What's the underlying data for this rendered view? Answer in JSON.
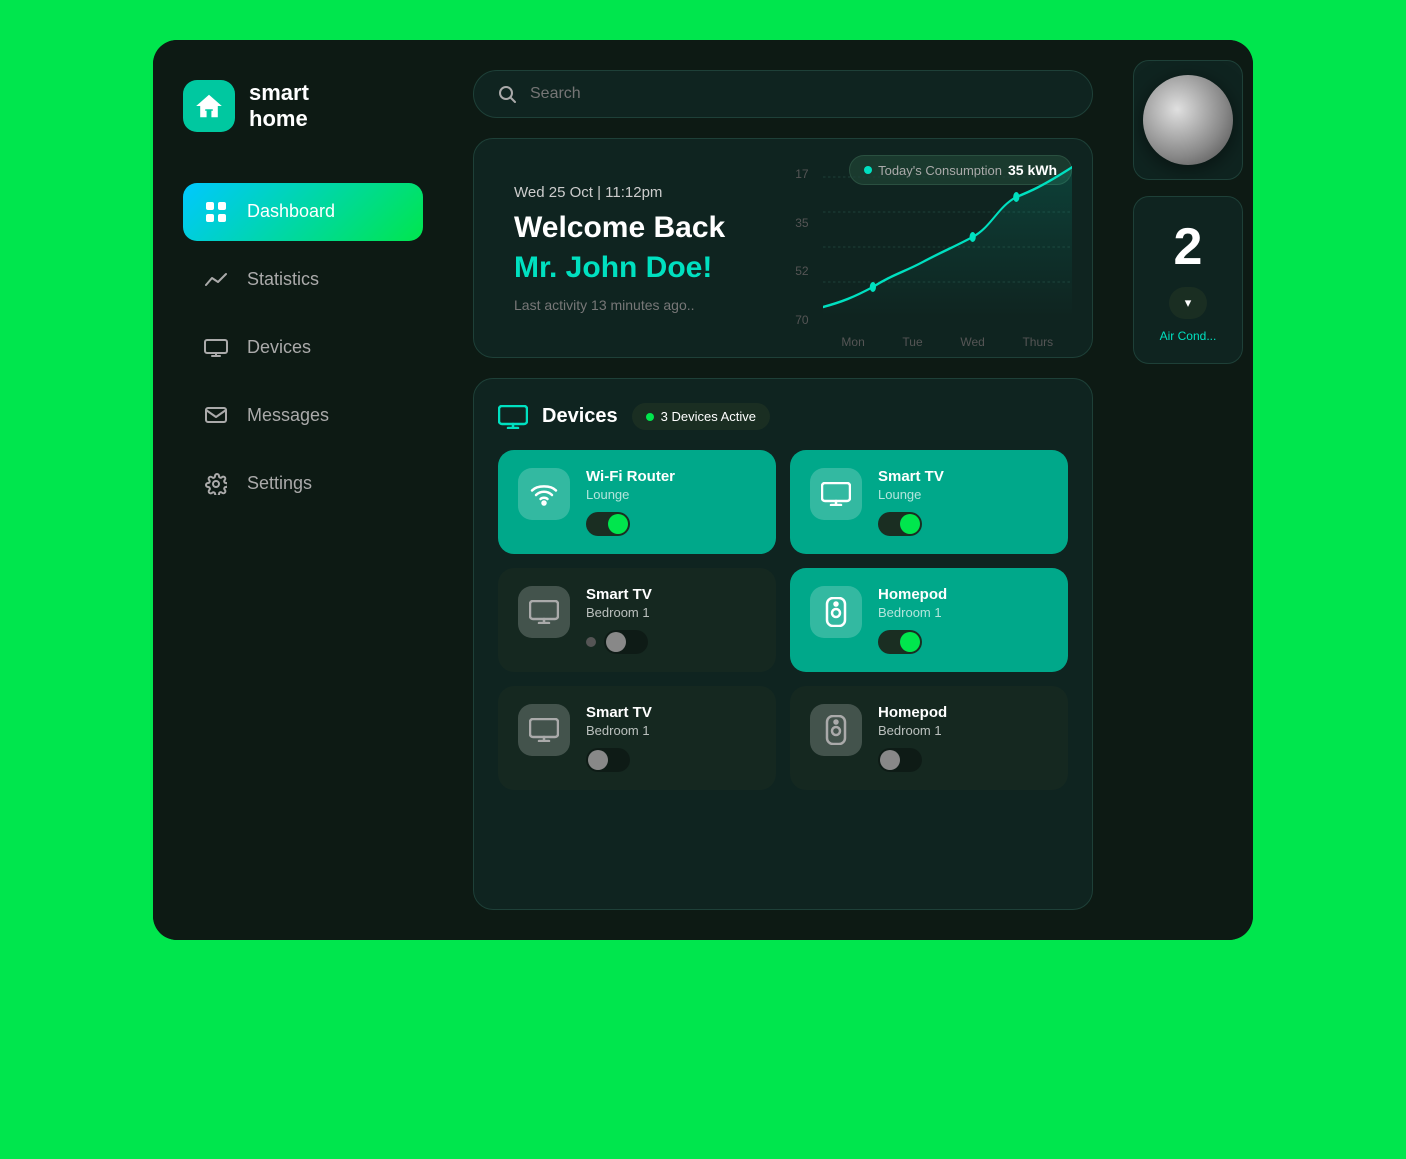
{
  "app": {
    "name": "smart home",
    "name_line1": "smart",
    "name_line2": "home"
  },
  "search": {
    "placeholder": "Search"
  },
  "nav": {
    "items": [
      {
        "id": "dashboard",
        "label": "Dashboard",
        "active": true
      },
      {
        "id": "statistics",
        "label": "Statistics",
        "active": false
      },
      {
        "id": "devices",
        "label": "Devices",
        "active": false
      },
      {
        "id": "messages",
        "label": "Messages",
        "active": false
      },
      {
        "id": "settings",
        "label": "Settings",
        "active": false
      }
    ]
  },
  "welcome": {
    "datetime": "Wed 25 Oct | 11:12pm",
    "heading": "Welcome Back",
    "name": "Mr. John Doe!",
    "activity": "Last activity 13 minutes ago.."
  },
  "chart": {
    "title": "Today's Consumption",
    "value": "35 kWh",
    "y_labels": [
      "70",
      "52",
      "35",
      "17",
      ""
    ],
    "x_labels": [
      "Mon",
      "Tue",
      "Wed",
      "Thurs"
    ]
  },
  "devices_section": {
    "title": "Devices",
    "badge": "3 Devices Active",
    "devices": [
      {
        "name": "Wi-Fi Router",
        "location": "Lounge",
        "state": "on",
        "type": "wifi"
      },
      {
        "name": "Smart TV",
        "location": "Lounge",
        "state": "on",
        "type": "tv"
      },
      {
        "name": "Smart TV",
        "location": "Bedroom 1",
        "state": "off",
        "type": "tv"
      },
      {
        "name": "Homepod",
        "location": "Bedroom 1",
        "state": "on",
        "type": "speaker"
      },
      {
        "name": "Smart TV",
        "location": "Bedroom 1",
        "state": "off",
        "type": "tv"
      },
      {
        "name": "Homepod",
        "location": "Bedroom 1",
        "state": "off",
        "type": "speaker"
      }
    ]
  },
  "right_panel": {
    "number": "2",
    "label": "Air Cond...",
    "dropdown_label": "v"
  }
}
